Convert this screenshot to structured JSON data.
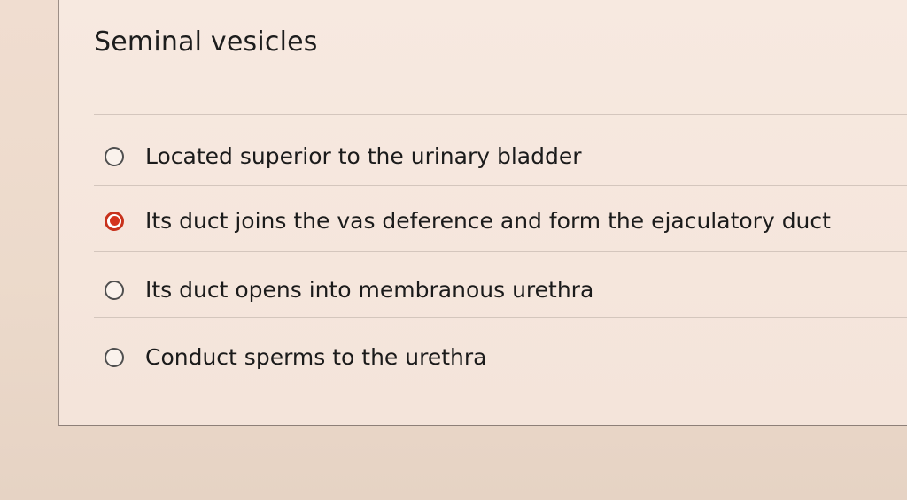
{
  "question": {
    "title": "Seminal vesicles"
  },
  "options": [
    {
      "label": "Located superior to the urinary bladder",
      "selected": false
    },
    {
      "label": "Its duct joins the vas deference and form the ejaculatory duct",
      "selected": true
    },
    {
      "label": "Its duct opens into membranous urethra",
      "selected": false
    },
    {
      "label": "Conduct sperms to the urethra",
      "selected": false
    }
  ],
  "colors": {
    "selected_radio": "#d4331d",
    "background": "#f0ddd0"
  }
}
